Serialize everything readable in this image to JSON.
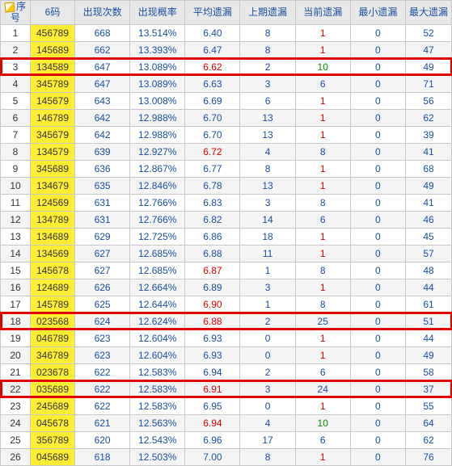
{
  "chart_data": {
    "type": "table",
    "title": "",
    "categories": [
      "序号",
      "6码",
      "出现次数",
      "出现概率",
      "平均遗漏",
      "上期遗漏",
      "当前遗漏",
      "最小遗漏",
      "最大遗漏"
    ]
  },
  "headers": [
    "序号",
    "6码",
    "出现次数",
    "出现概率",
    "平均遗漏",
    "上期遗漏",
    "当前遗漏",
    "最小遗漏",
    "最大遗漏"
  ],
  "highlightRows": [
    3,
    18,
    22
  ],
  "redAvgRows": [
    3,
    8,
    15,
    17,
    18,
    22,
    24
  ],
  "rows": [
    {
      "seq": 1,
      "code": "456789",
      "count": 668,
      "prob": "13.514%",
      "avg": "6.40",
      "last": 8,
      "cur": 1,
      "curCls": "red",
      "min": 0,
      "max": 52
    },
    {
      "seq": 2,
      "code": "145689",
      "count": 662,
      "prob": "13.393%",
      "avg": "6.47",
      "last": 8,
      "cur": 1,
      "curCls": "red",
      "min": 0,
      "max": 47
    },
    {
      "seq": 3,
      "code": "134589",
      "count": 647,
      "prob": "13.089%",
      "avg": "6.62",
      "last": 2,
      "cur": 10,
      "curCls": "green",
      "min": 0,
      "max": 49
    },
    {
      "seq": 4,
      "code": "345789",
      "count": 647,
      "prob": "13.089%",
      "avg": "6.63",
      "last": 3,
      "cur": 6,
      "curCls": "blue",
      "min": 0,
      "max": 71
    },
    {
      "seq": 5,
      "code": "145679",
      "count": 643,
      "prob": "13.008%",
      "avg": "6.69",
      "last": 6,
      "cur": 1,
      "curCls": "red",
      "min": 0,
      "max": 56
    },
    {
      "seq": 6,
      "code": "146789",
      "count": 642,
      "prob": "12.988%",
      "avg": "6.70",
      "last": 13,
      "cur": 1,
      "curCls": "red",
      "min": 0,
      "max": 62
    },
    {
      "seq": 7,
      "code": "345679",
      "count": 642,
      "prob": "12.988%",
      "avg": "6.70",
      "last": 13,
      "cur": 1,
      "curCls": "red",
      "min": 0,
      "max": 39
    },
    {
      "seq": 8,
      "code": "134579",
      "count": 639,
      "prob": "12.927%",
      "avg": "6.72",
      "last": 4,
      "cur": 8,
      "curCls": "blue",
      "min": 0,
      "max": 41
    },
    {
      "seq": 9,
      "code": "345689",
      "count": 636,
      "prob": "12.867%",
      "avg": "6.77",
      "last": 8,
      "cur": 1,
      "curCls": "red",
      "min": 0,
      "max": 68
    },
    {
      "seq": 10,
      "code": "134679",
      "count": 635,
      "prob": "12.846%",
      "avg": "6.78",
      "last": 13,
      "cur": 1,
      "curCls": "red",
      "min": 0,
      "max": 49
    },
    {
      "seq": 11,
      "code": "124569",
      "count": 631,
      "prob": "12.766%",
      "avg": "6.83",
      "last": 3,
      "cur": 8,
      "curCls": "blue",
      "min": 0,
      "max": 41
    },
    {
      "seq": 12,
      "code": "134789",
      "count": 631,
      "prob": "12.766%",
      "avg": "6.82",
      "last": 14,
      "cur": 6,
      "curCls": "blue",
      "min": 0,
      "max": 46
    },
    {
      "seq": 13,
      "code": "134689",
      "count": 629,
      "prob": "12.725%",
      "avg": "6.86",
      "last": 18,
      "cur": 1,
      "curCls": "red",
      "min": 0,
      "max": 45
    },
    {
      "seq": 14,
      "code": "134569",
      "count": 627,
      "prob": "12.685%",
      "avg": "6.88",
      "last": 11,
      "cur": 1,
      "curCls": "red",
      "min": 0,
      "max": 57
    },
    {
      "seq": 15,
      "code": "145678",
      "count": 627,
      "prob": "12.685%",
      "avg": "6.87",
      "last": 1,
      "cur": 8,
      "curCls": "blue",
      "min": 0,
      "max": 48
    },
    {
      "seq": 16,
      "code": "124689",
      "count": 626,
      "prob": "12.664%",
      "avg": "6.89",
      "last": 3,
      "cur": 1,
      "curCls": "red",
      "min": 0,
      "max": 44
    },
    {
      "seq": 17,
      "code": "145789",
      "count": 625,
      "prob": "12.644%",
      "avg": "6.90",
      "last": 1,
      "cur": 8,
      "curCls": "blue",
      "min": 0,
      "max": 61
    },
    {
      "seq": 18,
      "code": "023568",
      "count": 624,
      "prob": "12.624%",
      "avg": "6.88",
      "last": 2,
      "cur": 25,
      "curCls": "blue",
      "min": 0,
      "max": 51
    },
    {
      "seq": 19,
      "code": "046789",
      "count": 623,
      "prob": "12.604%",
      "avg": "6.93",
      "last": 0,
      "cur": 1,
      "curCls": "red",
      "min": 0,
      "max": 44
    },
    {
      "seq": 20,
      "code": "346789",
      "count": 623,
      "prob": "12.604%",
      "avg": "6.93",
      "last": 0,
      "cur": 1,
      "curCls": "red",
      "min": 0,
      "max": 49
    },
    {
      "seq": 21,
      "code": "023678",
      "count": 622,
      "prob": "12.583%",
      "avg": "6.94",
      "last": 2,
      "cur": 6,
      "curCls": "blue",
      "min": 0,
      "max": 58
    },
    {
      "seq": 22,
      "code": "035689",
      "count": 622,
      "prob": "12.583%",
      "avg": "6.91",
      "last": 3,
      "cur": 24,
      "curCls": "blue",
      "min": 0,
      "max": 37
    },
    {
      "seq": 23,
      "code": "245689",
      "count": 622,
      "prob": "12.583%",
      "avg": "6.95",
      "last": 0,
      "cur": 1,
      "curCls": "red",
      "min": 0,
      "max": 55
    },
    {
      "seq": 24,
      "code": "045678",
      "count": 621,
      "prob": "12.563%",
      "avg": "6.94",
      "last": 4,
      "cur": 10,
      "curCls": "green",
      "min": 0,
      "max": 64
    },
    {
      "seq": 25,
      "code": "356789",
      "count": 620,
      "prob": "12.543%",
      "avg": "6.96",
      "last": 17,
      "cur": 6,
      "curCls": "blue",
      "min": 0,
      "max": 62
    },
    {
      "seq": 26,
      "code": "045689",
      "count": 618,
      "prob": "12.503%",
      "avg": "7.00",
      "last": 8,
      "cur": 1,
      "curCls": "red",
      "min": 0,
      "max": 76
    }
  ]
}
